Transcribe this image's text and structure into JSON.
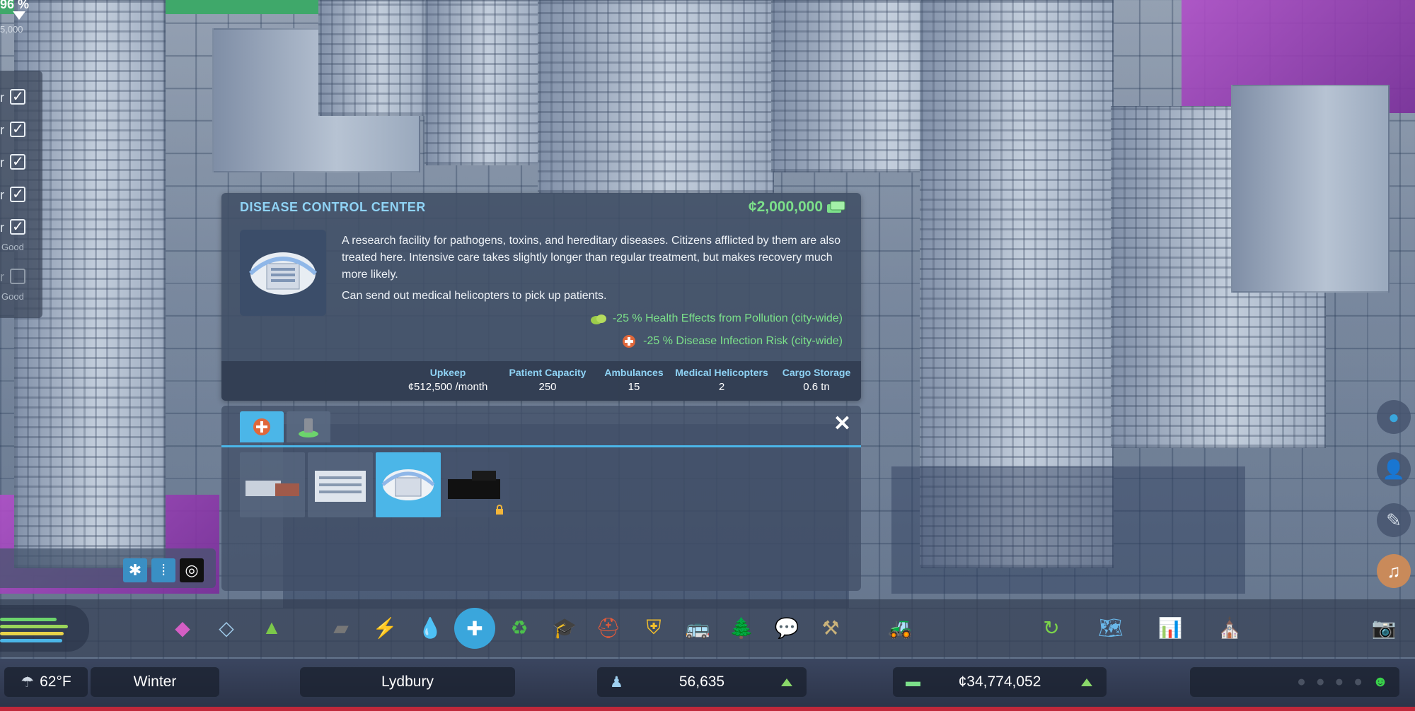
{
  "top_left": {
    "percent": "96 %",
    "sub_value": "5,000",
    "rows": [
      {
        "label": "r",
        "checked": true,
        "status": ""
      },
      {
        "label": "r",
        "checked": true,
        "status": ""
      },
      {
        "label": "r",
        "checked": true,
        "status": ""
      },
      {
        "label": "r",
        "checked": true,
        "status": ""
      },
      {
        "label": "r",
        "checked": true,
        "status": "Good"
      },
      {
        "label": "r",
        "checked": false,
        "status": "Good"
      }
    ]
  },
  "building": {
    "title": "DISEASE CONTROL CENTER",
    "price": "¢2,000,000",
    "description_1": "A research facility for pathogens, toxins, and hereditary diseases. Citizens afflicted by them are also treated here. Intensive care takes slightly longer than regular treatment, but makes recovery much more likely.",
    "description_2": "Can send out medical helicopters to pick up patients.",
    "effects": [
      {
        "text": "-25 % Health Effects from Pollution (city-wide)",
        "icon": "pollution-cloud-icon"
      },
      {
        "text": "-25 % Disease Infection Risk (city-wide)",
        "icon": "health-cross-icon"
      }
    ],
    "stats": [
      {
        "label": "Upkeep",
        "value": "¢512,500 /month"
      },
      {
        "label": "Patient Capacity",
        "value": "250"
      },
      {
        "label": "Ambulances",
        "value": "15"
      },
      {
        "label": "Medical Helicopters",
        "value": "2"
      },
      {
        "label": "Cargo Storage",
        "value": "0.6 tn"
      }
    ]
  },
  "selector": {
    "tabs": [
      "health-tab",
      "deathcare-tab"
    ],
    "close_label": "✕",
    "items": [
      "clinic",
      "hospital",
      "disease-control-center",
      "locked-building"
    ]
  },
  "tools": {
    "snap_label": "✱",
    "grid_label": "⁞",
    "circle_label": "◎"
  },
  "toolbar": {
    "icons": [
      "zoning-icon",
      "area-icon",
      "landscaping-icon",
      "roads-icon",
      "electricity-icon",
      "water-icon",
      "health-icon",
      "garbage-icon",
      "education-icon",
      "fire-icon",
      "police-icon",
      "transport-icon",
      "parks-icon",
      "communications-icon",
      "shovel-icon",
      "bulldozer-icon"
    ],
    "right_icons": [
      "advisor-icon",
      "map-icon",
      "stats-icon",
      "landmark-icon",
      "photo-mode-icon"
    ]
  },
  "status_bar": {
    "temperature": "62°F",
    "season": "Winter",
    "city_name": "Lydbury",
    "population": "56,635",
    "money": "¢34,774,052"
  },
  "colors": {
    "accent": "#4bb6e8",
    "price_green": "#7ce08a",
    "panel_bg": "#404e65",
    "status_red": "#c0283a"
  }
}
